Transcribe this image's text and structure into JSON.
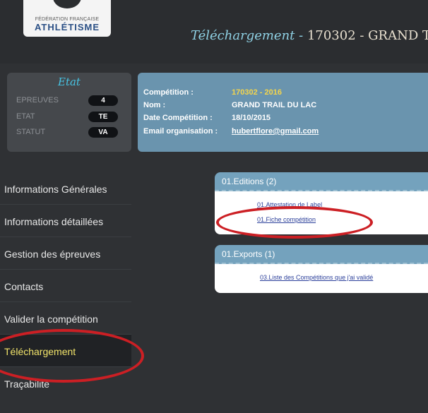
{
  "header": {
    "logo_top": "FÉDÉRATION FRANÇAISE",
    "logo_main": "ATHLÉTISME",
    "title_prefix": "Téléchargement - ",
    "title_rest": "170302 - GRAND T"
  },
  "etat": {
    "title": "Etat",
    "rows": [
      {
        "label": "EPREUVES",
        "value": "4"
      },
      {
        "label": "ETAT",
        "value": "TE"
      },
      {
        "label": "STATUT",
        "value": "VA"
      }
    ]
  },
  "competition": {
    "rows": [
      {
        "label": "Compétition :",
        "value": "170302 - 2016"
      },
      {
        "label": "Nom :",
        "value": "GRAND TRAIL DU LAC"
      },
      {
        "label": "Date Compétition :",
        "value": "18/10/2015"
      },
      {
        "label": "Email organisation :",
        "value": "hubertflore@gmail.com"
      }
    ]
  },
  "sidebar": {
    "items": [
      {
        "label": "Informations Générales"
      },
      {
        "label": "Informations détaillées"
      },
      {
        "label": "Gestion des épreuves"
      },
      {
        "label": "Contacts"
      },
      {
        "label": "Valider la compétition"
      },
      {
        "label": "Téléchargement"
      },
      {
        "label": "Traçabilité"
      }
    ],
    "active_index": 5
  },
  "panels": {
    "editions": {
      "title": "01.Editions (2)",
      "links": [
        "01.Attestation de Label",
        "01.Fiche compétition"
      ]
    },
    "exports": {
      "title": "01.Exports (1)",
      "links": [
        "03.Liste des Compétitions que j'ai validé"
      ]
    }
  },
  "colors": {
    "highlight": "#cc1f24",
    "accent": "#47c4e4",
    "active_text": "#f2e46a"
  }
}
